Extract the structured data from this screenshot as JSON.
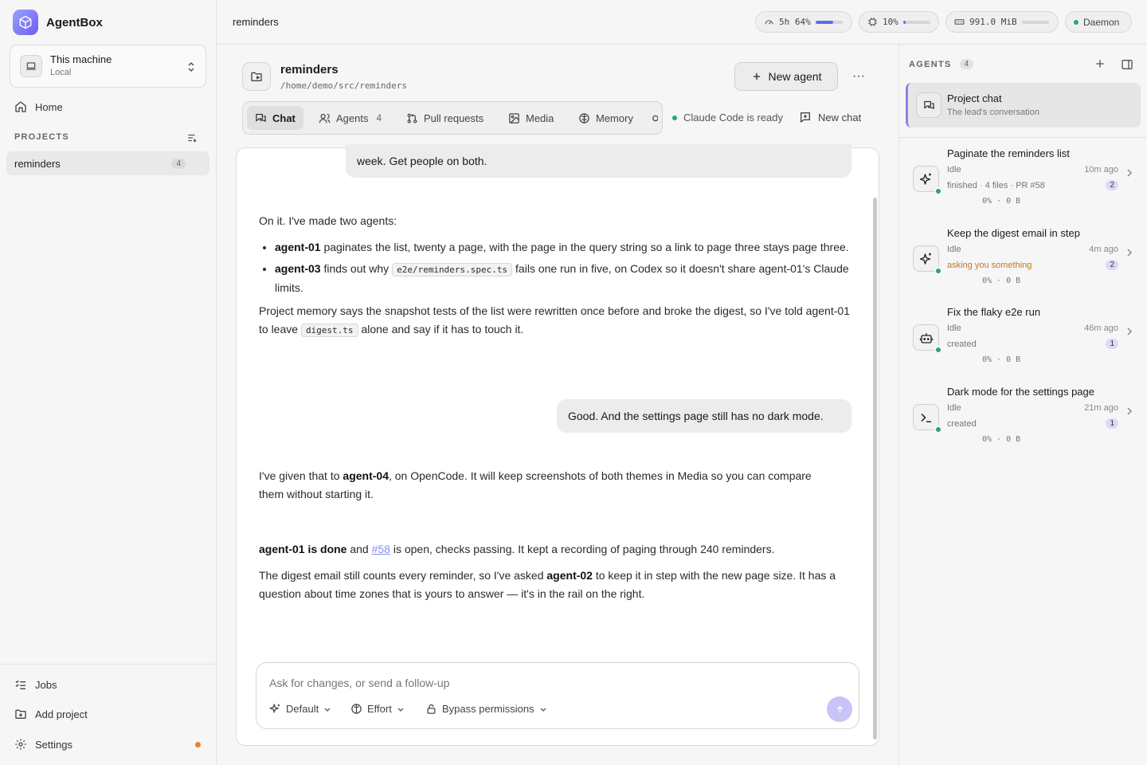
{
  "sidebar": {
    "app_name": "AgentBox",
    "machine": {
      "title": "This machine",
      "subtitle": "Local"
    },
    "home_label": "Home",
    "projects_header": "PROJECTS",
    "projects": [
      {
        "name": "reminders",
        "count": "4"
      }
    ],
    "bottom": {
      "jobs": "Jobs",
      "add_project": "Add project",
      "settings": "Settings"
    }
  },
  "topbar": {
    "breadcrumb": "reminders",
    "usage": {
      "label": "5h 64%",
      "fill": 0.64
    },
    "cpu": {
      "label": "10%",
      "fill": 0.1
    },
    "memory": {
      "label": "991.0 MiB",
      "fill": 0.0
    },
    "daemon": "Daemon"
  },
  "project": {
    "title": "reminders",
    "path": "/home/demo/src/reminders",
    "new_agent": "New agent",
    "more": "···"
  },
  "tabs": [
    {
      "label": "Chat",
      "count": ""
    },
    {
      "label": "Agents",
      "count": "4"
    },
    {
      "label": "Pull requests",
      "count": ""
    },
    {
      "label": "Media",
      "count": ""
    },
    {
      "label": "Memory",
      "count": ""
    }
  ],
  "status": {
    "ready": "Claude Code is ready",
    "new_chat": "New chat"
  },
  "chat": {
    "user_1": "week. Get people on both.",
    "reply_1": {
      "intro": "On it. I've made two agents:",
      "b1_name": "agent-01",
      "b1_text": "paginates the list, twenty a page, with the page in the query string so a link to page three stays page three.",
      "b2_name": "agent-03",
      "b2_pre": "finds out why",
      "b2_code": "e2e/reminders.spec.ts",
      "b2_post": "fails one run in five, on Codex so it doesn't share agent-01's Claude limits.",
      "memory_pre": "Project memory says the snapshot tests of the list were rewritten once before and broke the digest, so I've told agent-01 to leave",
      "memory_code": "digest.ts",
      "memory_post": "alone and say if it has to touch it."
    },
    "user_2": "Good. And the settings page still has no dark mode.",
    "reply_2": {
      "pre": "I've given that to",
      "name": "agent-04",
      "post": ", on OpenCode. It will keep screenshots of both themes in Media so you can compare them without starting it."
    },
    "reply_3": {
      "done": "agent-01 is done",
      "and": "and",
      "pr": "#58",
      "post": "is open, checks passing. It kept a recording of paging through 240 reminders.",
      "digest_pre": "The digest email still counts every reminder, so I've asked",
      "digest_name": "agent-02",
      "digest_post": "to keep it in step with the new page size. It has a question about time zones that is yours to answer — it's in the rail on the right."
    },
    "composer": {
      "placeholder": "Ask for changes, or send a follow-up",
      "model": "Default",
      "effort": "Effort",
      "permissions": "Bypass permissions"
    }
  },
  "rail": {
    "header": "AGENTS",
    "count": "4",
    "project_chat": {
      "title": "Project chat",
      "subtitle": "The lead's conversation"
    },
    "agents": [
      {
        "title": "Paginate the reminders list",
        "state": "Idle",
        "ago": "10m ago",
        "detail": "finished · 4 files · PR #58",
        "badge": "2",
        "stats": "0% · 0 B",
        "icon": "sparkle-icon"
      },
      {
        "title": "Keep the digest email in step",
        "state": "Idle",
        "ago": "4m ago",
        "detail": "asking you something",
        "badge": "2",
        "stats": "0% · 0 B",
        "icon": "sparkle-icon"
      },
      {
        "title": "Fix the flaky e2e run",
        "state": "Idle",
        "ago": "46m ago",
        "detail": "created",
        "badge": "1",
        "stats": "0% · 0 B",
        "icon": "robot-icon"
      },
      {
        "title": "Dark mode for the settings page",
        "state": "Idle",
        "ago": "21m ago",
        "detail": "created",
        "badge": "1",
        "stats": "0% · 0 B",
        "icon": "terminal-icon"
      }
    ]
  },
  "colors": {
    "accent": "#6d5cf0",
    "status_green": "#2aa56a",
    "warning": "#c0781f",
    "link": "#8a8ef5"
  }
}
